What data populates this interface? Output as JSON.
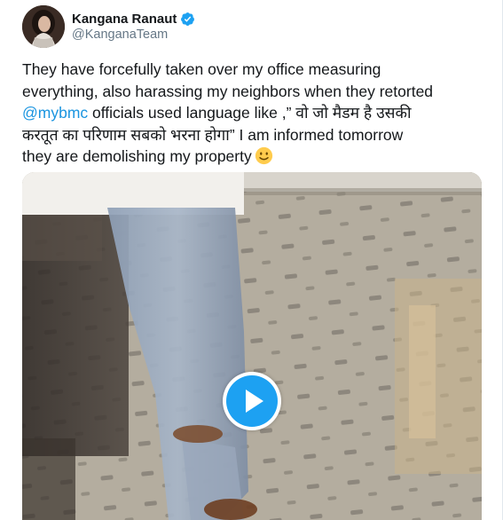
{
  "author": {
    "display_name": "Kangana Ranaut",
    "handle": "@KanganaTeam",
    "avatar_icon": "profile-photo",
    "verified_icon": "verified-badge-icon"
  },
  "tweet": {
    "line1": "They have forcefully taken over my office measuring",
    "line2": "everything, also harassing my neighbors when they retorted",
    "mention": "@mybmc",
    "line3_rest": " officials used language like ,” वो जो मैडम है उसकी",
    "line4": "करतूत का परिणाम सबको भरना होगा” I am informed tomorrow",
    "line5": "they are demolishing my property",
    "emoji_icon": "slightly-smiling-face-icon"
  },
  "media": {
    "type": "video",
    "play_icon": "play-icon"
  },
  "colors": {
    "link": "#1b95e0",
    "verified": "#1da1f2",
    "play": "#1da1f2",
    "handle": "#657786"
  }
}
